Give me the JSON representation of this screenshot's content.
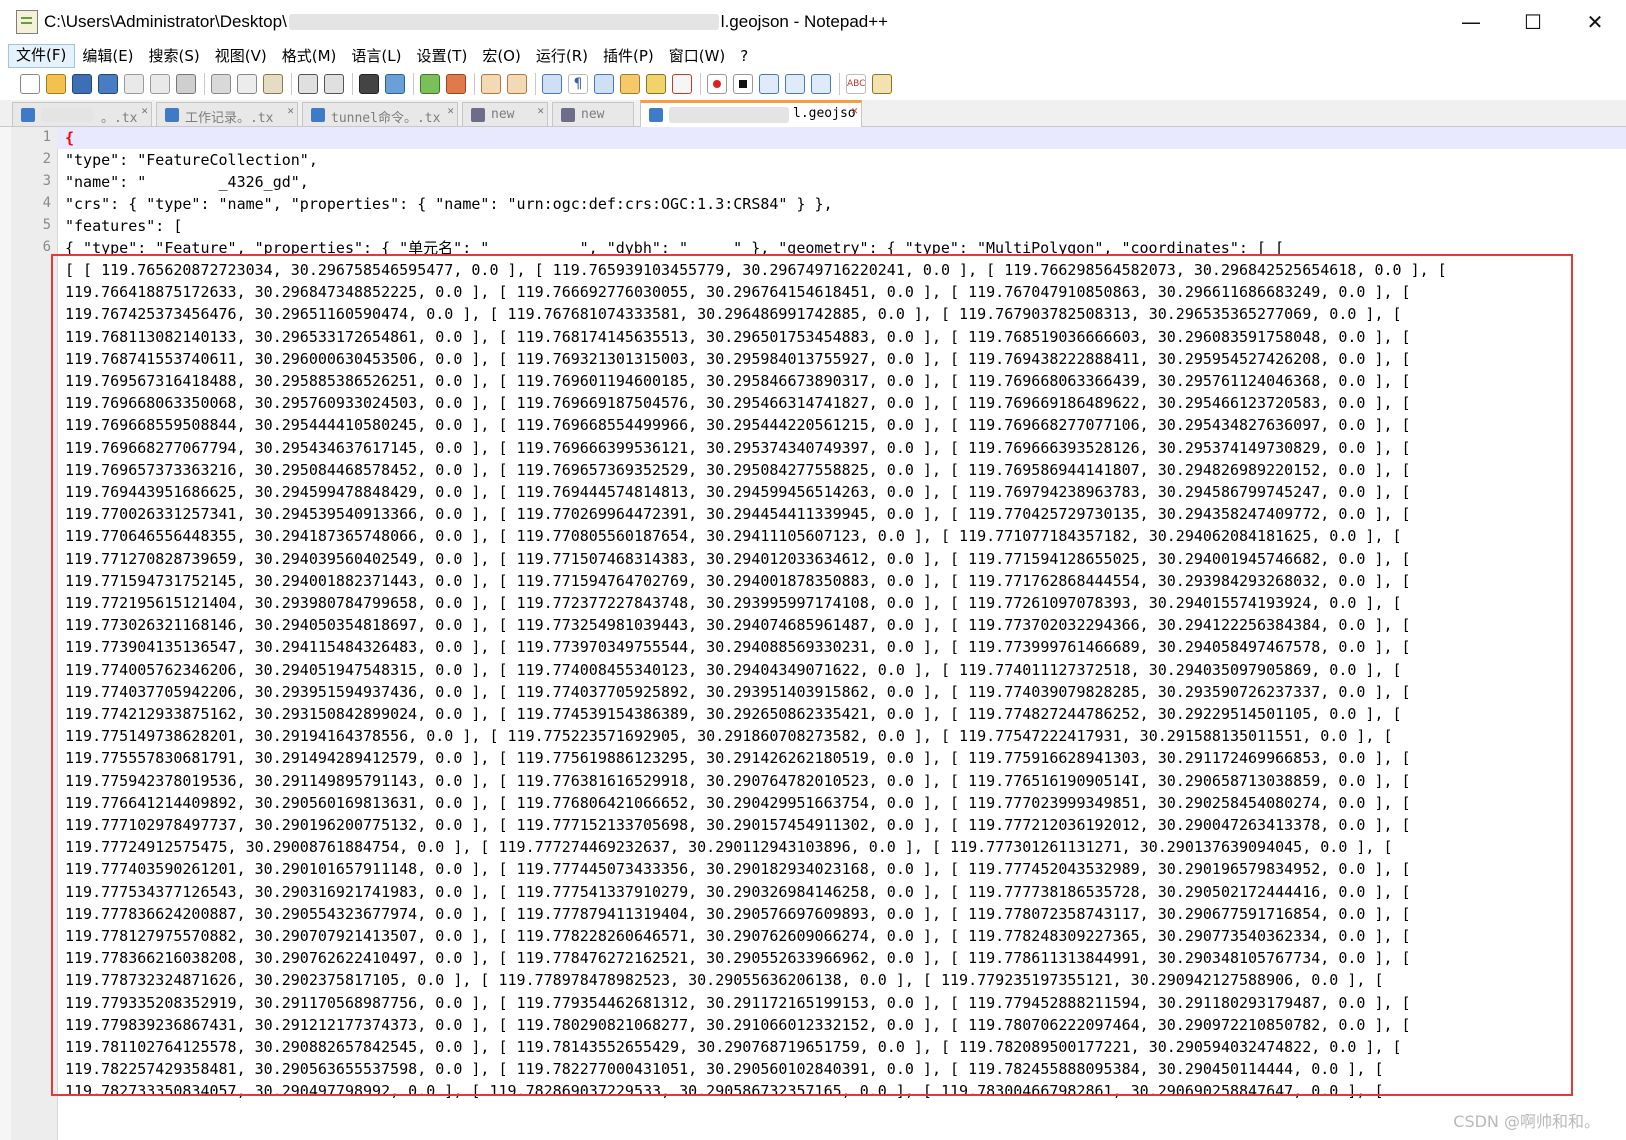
{
  "window": {
    "title_prefix": "C:\\Users\\Administrator\\Desktop\\",
    "title_suffix": "l.geojson - Notepad++",
    "controls": [
      "—",
      "☐",
      "✕"
    ]
  },
  "menu": [
    "文件(F)",
    "编辑(E)",
    "搜索(S)",
    "视图(V)",
    "格式(M)",
    "语言(L)",
    "设置(T)",
    "宏(O)",
    "运行(R)",
    "插件(P)",
    "窗口(W)",
    "?"
  ],
  "tabs": [
    {
      "label": "。.tx"
    },
    {
      "label": "工作记录。.tx"
    },
    {
      "label": "tunnel命令。.tx"
    },
    {
      "label": "new"
    },
    {
      "label": "new"
    },
    {
      "label": "l.geojso"
    }
  ],
  "editor": {
    "header_lines": [
      "{",
      "\"type\": \"FeatureCollection\",",
      "\"name\": \"        _4326_gd\",",
      "\"crs\": { \"type\": \"name\", \"properties\": { \"name\": \"urn:ogc:def:crs:OGC:1.3:CRS84\" } },",
      "\"features\": [",
      "{ \"type\": \"Feature\", \"properties\": { \"单元名\": \"          \", \"dybh\": \"     \" }, \"geometry\": { \"type\": \"MultiPolygon\", \"coordinates\": [ ["
    ],
    "wrapped_lines": [
      "[ [ 119.765620872723034, 30.296758546595477, 0.0 ], [ 119.765939103455779, 30.296749716220241, 0.0 ], [ 119.766298564582073, 30.296842525654618, 0.0 ], [",
      "119.766418875172633, 30.296847348852225, 0.0 ], [ 119.766692776030055, 30.296764154618451, 0.0 ], [ 119.767047910850863, 30.296611686683249, 0.0 ], [",
      "119.767425373456476, 30.29651160590474, 0.0 ], [ 119.767681074333581, 30.296486991742885, 0.0 ], [ 119.767903782508313, 30.296535365277069, 0.0 ], [",
      "119.768113082140133, 30.296533172654861, 0.0 ], [ 119.768174145635513, 30.296501753454883, 0.0 ], [ 119.768519036666603, 30.296083591758048, 0.0 ], [",
      "119.768741553740611, 30.296000630453506, 0.0 ], [ 119.769321301315003, 30.295984013755927, 0.0 ], [ 119.769438222888411, 30.295954527426208, 0.0 ], [",
      "119.769567316418488, 30.295885386526251, 0.0 ], [ 119.769601194600185, 30.295846673890317, 0.0 ], [ 119.769668063366439, 30.295761124046368, 0.0 ], [",
      "119.769668063350068, 30.295760933024503, 0.0 ], [ 119.769669187504576, 30.295466314741827, 0.0 ], [ 119.769669186489622, 30.295466123720583, 0.0 ], [",
      "119.769668559508844, 30.295444410580245, 0.0 ], [ 119.769668554499966, 30.295444220561215, 0.0 ], [ 119.769668277077106, 30.295434827636097, 0.0 ], [",
      "119.769668277067794, 30.295434637617145, 0.0 ], [ 119.769666399536121, 30.295374340749397, 0.0 ], [ 119.769666393528126, 30.295374149730829, 0.0 ], [",
      "119.769657373363216, 30.295084468578452, 0.0 ], [ 119.769657369352529, 30.295084277558825, 0.0 ], [ 119.769586944141807, 30.294826989220152, 0.0 ], [",
      "119.769443951686625, 30.294599478848429, 0.0 ], [ 119.769444574814813, 30.294599456514263, 0.0 ], [ 119.769794238963783, 30.294586799745247, 0.0 ], [",
      "119.770026331257341, 30.294539540913366, 0.0 ], [ 119.770269964472391, 30.294454411339945, 0.0 ], [ 119.770425729730135, 30.294358247409772, 0.0 ], [",
      "119.770646556448355, 30.294187365748066, 0.0 ], [ 119.770805560187654, 30.29411105607123, 0.0 ], [ 119.771077184357182, 30.294062084181625, 0.0 ], [",
      "119.771270828739659, 30.294039560402549, 0.0 ], [ 119.771507468314383, 30.294012033634612, 0.0 ], [ 119.771594128655025, 30.294001945746682, 0.0 ], [",
      "119.771594731752145, 30.294001882371443, 0.0 ], [ 119.771594764702769, 30.294001878350883, 0.0 ], [ 119.771762868444554, 30.293984293268032, 0.0 ], [",
      "119.772195615121404, 30.293980784799658, 0.0 ], [ 119.772377227843748, 30.293995997174108, 0.0 ], [ 119.77261097078393, 30.294015574193924, 0.0 ], [",
      "119.773026321168146, 30.294050354818697, 0.0 ], [ 119.773254981039443, 30.294074685961487, 0.0 ], [ 119.773702032294366, 30.294122256384384, 0.0 ], [",
      "119.773904135136547, 30.294115484326483, 0.0 ], [ 119.773970349755544, 30.294088569330231, 0.0 ], [ 119.773999761466689, 30.294058497467578, 0.0 ], [",
      "119.774005762346206, 30.294051947548315, 0.0 ], [ 119.774008455340123, 30.29404349071622, 0.0 ], [ 119.774011127372518, 30.294035097905869, 0.0 ], [",
      "119.774037705942206, 30.293951594937436, 0.0 ], [ 119.774037705925892, 30.293951403915862, 0.0 ], [ 119.774039079828285, 30.293590726237337, 0.0 ], [",
      "119.774212933875162, 30.293150842899024, 0.0 ], [ 119.774539154386389, 30.292650862335421, 0.0 ], [ 119.774827244786252, 30.29229514501105, 0.0 ], [",
      "119.775149738628201, 30.29194164378556, 0.0 ], [ 119.775223571692905, 30.291860708273582, 0.0 ], [ 119.77547222417931, 30.291588135011551, 0.0 ], [",
      "119.775557830681791, 30.291494289412579, 0.0 ], [ 119.775619886123295, 30.291426262180519, 0.0 ], [ 119.775916628941303, 30.291172469966853, 0.0 ], [",
      "119.775942378019536, 30.291149895791143, 0.0 ], [ 119.776381616529918, 30.290764782010523, 0.0 ], [ 119.77651619090514I, 30.290658713038859, 0.0 ], [",
      "119.776641214409892, 30.290560169813631, 0.0 ], [ 119.776806421066652, 30.290429951663754, 0.0 ], [ 119.777023999349851, 30.290258454080274, 0.0 ], [",
      "119.777102978497737, 30.290196200775132, 0.0 ], [ 119.777152133705698, 30.290157454911302, 0.0 ], [ 119.777212036192012, 30.290047263413378, 0.0 ], [",
      "119.77724912575475, 30.29008761884754, 0.0 ], [ 119.777274469232637, 30.290112943103896, 0.0 ], [ 119.777301261131271, 30.290137639094045, 0.0 ], [",
      "119.777403590261201, 30.290101657911148, 0.0 ], [ 119.777445073433356, 30.290182934023168, 0.0 ], [ 119.777452043532989, 30.290196579834952, 0.0 ], [",
      "119.777534377126543, 30.290316921741983, 0.0 ], [ 119.777541337910279, 30.290326984146258, 0.0 ], [ 119.777738186535728, 30.290502172444416, 0.0 ], [",
      "119.777836624200887, 30.290554323677974, 0.0 ], [ 119.777879411319404, 30.290576697609893, 0.0 ], [ 119.778072358743117, 30.290677591716854, 0.0 ], [",
      "119.778127975570882, 30.290707921413507, 0.0 ], [ 119.778228260646571, 30.290762609066274, 0.0 ], [ 119.778248309227365, 30.290773540362334, 0.0 ], [",
      "119.778366216038208, 30.290762622410497, 0.0 ], [ 119.778476272162521, 30.290552633966962, 0.0 ], [ 119.778611313844991, 30.290348105767734, 0.0 ], [",
      "119.778732324871626, 30.2902375817105, 0.0 ], [ 119.778978478982523, 30.29055636206138, 0.0 ], [ 119.779235197355121, 30.290942127588906, 0.0 ], [",
      "119.779335208352919, 30.291170568987756, 0.0 ], [ 119.779354462681312, 30.291172165199153, 0.0 ], [ 119.779452888211594, 30.291180293179487, 0.0 ], [",
      "119.779839236867431, 30.291212177374373, 0.0 ], [ 119.780290821068277, 30.291066012332152, 0.0 ], [ 119.780706222097464, 30.290972210850782, 0.0 ], [",
      "119.781102764125578, 30.290882657842545, 0.0 ], [ 119.78143552655429, 30.290768719651759, 0.0 ], [ 119.782089500177221, 30.290594032474822, 0.0 ], [",
      "119.782257429358481, 30.290563655537598, 0.0 ], [ 119.782277000431051, 30.290560102840391, 0.0 ], [ 119.782455888095384, 30.290450114444, 0.0 ], [",
      "119.782733350834057, 30.290497798992, 0.0 ], [ 119.782869037229533, 30.290586732357165, 0.0 ], [ 119.783004667982861, 30.290690258847647, 0.0 ], ["
    ],
    "line_numbers": [
      "1",
      "2",
      "3",
      "4",
      "5",
      "6"
    ]
  },
  "watermark": "CSDN @啊帅和和。"
}
